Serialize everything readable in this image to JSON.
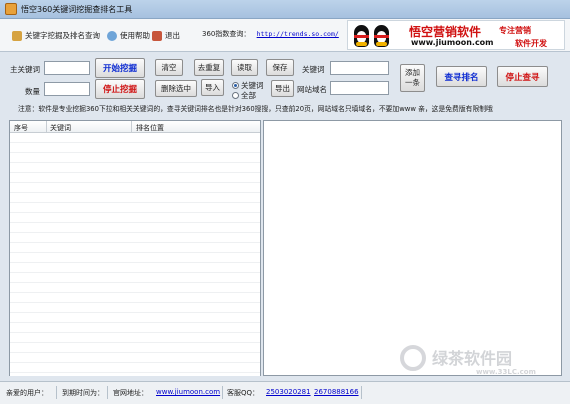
{
  "window": {
    "title": "悟空360关键词挖掘查排名工具"
  },
  "menu": {
    "items": [
      {
        "label": "关键字挖掘及排名查询",
        "icon": "keyword-icon"
      },
      {
        "label": "使用帮助",
        "icon": "help-icon"
      },
      {
        "label": "退出",
        "icon": "exit-icon"
      }
    ],
    "trends_label": "360指数查询：",
    "trends_url": "http://trends.so.com/"
  },
  "banner": {
    "brand": "悟空营销软件",
    "url": "www.jiumoon.com",
    "slogan1": "专注营销",
    "slogan2": "软件开发"
  },
  "form": {
    "main_keyword_label": "主关键词",
    "main_keyword_value": "",
    "count_label": "数量",
    "count_value": "",
    "start_button": "开始挖掘",
    "stop_button": "停止挖掘",
    "clear_button": "清空",
    "dedupe_button": "去重复",
    "read_button": "读取",
    "save_button": "保存",
    "delete_button": "删除选中",
    "import_button": "导入",
    "export_button": "导出",
    "radio_keyword": "关键词",
    "radio_all": "全部",
    "keyword_label": "关键词",
    "keyword_value": "",
    "site_label": "网站域名",
    "site_value": "",
    "add_button_line1": "添加",
    "add_button_line2": "一条",
    "query_rank_button": "查寻排名",
    "stop_query_button": "停止查寻"
  },
  "notice": "注意：软件是专业挖掘360下拉和相关关键词的，查寻关键词排名也是针对360搜搜，只查前20页，网站域名只填域名，不要加www    亲，这是免费版有限制哦",
  "table": {
    "columns": [
      "序号",
      "关键词",
      "排名位置"
    ],
    "rows": []
  },
  "status": {
    "user_label": "亲爱的用户：",
    "expire_label": "到期时间为：",
    "site_label": "官网地址：",
    "site_url": "www.jiumoon.com",
    "qq_label": "客服QQ：",
    "qq1": "2503020281",
    "qq2": "2670888166"
  },
  "watermark": {
    "text": "绿茶软件园",
    "url": "www.33LC.com"
  }
}
